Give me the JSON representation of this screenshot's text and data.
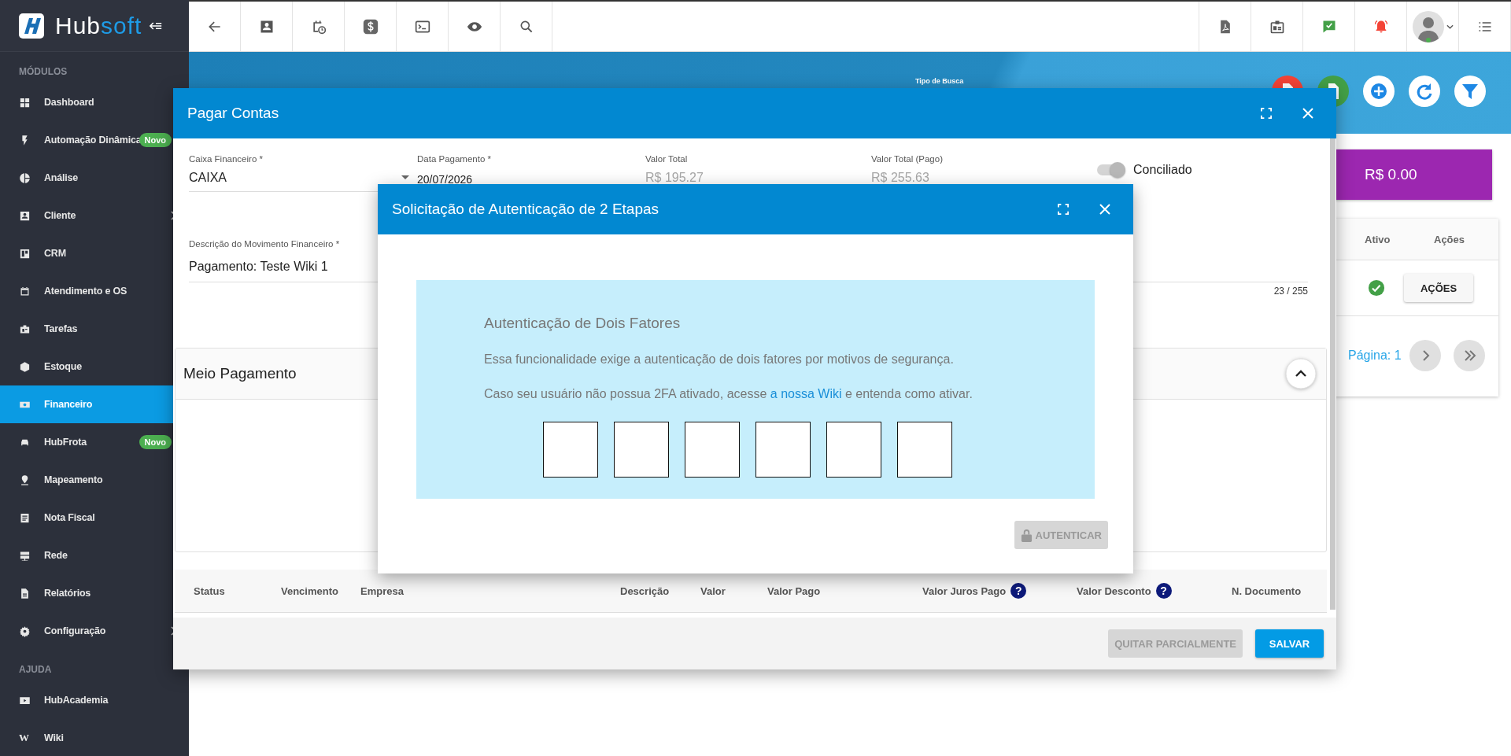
{
  "sidebar": {
    "logo": {
      "primary": "Hub",
      "accent": "soft"
    },
    "sections": [
      {
        "heading": "MÓDULOS",
        "items": [
          {
            "label": "Dashboard",
            "selected": false,
            "expandable": false
          },
          {
            "label": "Automação Dinâmica",
            "selected": false,
            "expandable": false,
            "badge": "Novo"
          },
          {
            "label": "Análise",
            "selected": false,
            "expandable": false
          },
          {
            "label": "Cliente",
            "selected": false,
            "expandable": true
          },
          {
            "label": "CRM",
            "selected": false,
            "expandable": false
          },
          {
            "label": "Atendimento e OS",
            "selected": false,
            "expandable": false
          },
          {
            "label": "Tarefas",
            "selected": false,
            "expandable": false
          },
          {
            "label": "Estoque",
            "selected": false,
            "expandable": false
          },
          {
            "label": "Financeiro",
            "selected": true,
            "expandable": false
          },
          {
            "label": "HubFrota",
            "selected": false,
            "expandable": false,
            "badge": "Novo"
          },
          {
            "label": "Mapeamento",
            "selected": false,
            "expandable": false
          },
          {
            "label": "Nota Fiscal",
            "selected": false,
            "expandable": false
          },
          {
            "label": "Rede",
            "selected": false,
            "expandable": false
          },
          {
            "label": "Relatórios",
            "selected": false,
            "expandable": false
          },
          {
            "label": "Configuração",
            "selected": false,
            "expandable": true
          }
        ]
      },
      {
        "heading": "AJUDA",
        "items": [
          {
            "label": "HubAcademia",
            "selected": false,
            "expandable": false
          },
          {
            "label": "Wiki",
            "selected": false,
            "expandable": false,
            "glyph": "W"
          }
        ]
      }
    ]
  },
  "header": {
    "search_type_label": "Tipo de Busca"
  },
  "summary": {
    "total": "R$ 0.00"
  },
  "list": {
    "columns": [
      "Ativo",
      "Ações"
    ],
    "rows": [
      {
        "active": true,
        "action": "AÇÕES"
      }
    ],
    "pagination": "Página: 1"
  },
  "payment_dialog": {
    "title": "Pagar Contas",
    "fields": [
      {
        "kind": "select",
        "label": "Caixa Financeiro *",
        "value": "CAIXA",
        "disabled": false
      },
      {
        "kind": "date",
        "label": "Data Pagamento *",
        "value": "20/07/2026",
        "disabled": false
      },
      {
        "kind": "readonly",
        "label": "Valor Total",
        "value": "R$ 195.27",
        "disabled": true
      },
      {
        "kind": "readonly",
        "label": "Valor Total (Pago)",
        "value": "R$ 255.63",
        "disabled": true
      }
    ],
    "toggle": {
      "label": "Conciliado",
      "on": true,
      "disabled": true
    },
    "description": {
      "label": "Descrição do Movimento Financeiro *",
      "value": "Pagamento: Teste Wiki 1",
      "counter": "23 / 255"
    },
    "payment_method": {
      "title": "Meio Pagamento",
      "expanded": true
    },
    "table": {
      "columns": [
        {
          "label": "Status"
        },
        {
          "label": "Vencimento"
        },
        {
          "label": "Empresa"
        },
        {
          "label": "Descrição"
        },
        {
          "label": "Valor"
        },
        {
          "label": "Valor Pago"
        },
        {
          "label": "Valor Juros Pago",
          "help": "?"
        },
        {
          "label": "Valor Desconto",
          "help": "?"
        },
        {
          "label": "N. Documento"
        }
      ]
    },
    "buttons": [
      {
        "label": "QUITAR PARCIALMENTE",
        "disabled": true
      },
      {
        "label": "SALVAR",
        "disabled": false
      }
    ]
  },
  "auth_dialog": {
    "title": "Solicitação de Autenticação de 2 Etapas",
    "heading": "Autenticação de Dois Fatores",
    "text": "Essa funcionalidade exige a autenticação de dois fatores por motivos de segurança.",
    "help": {
      "before": "Caso seu usuário não possua 2FA ativado, acesse ",
      "link": "a nossa Wiki",
      "after": " e entenda como ativar."
    },
    "code_fields": [
      {
        "kind": "digit"
      },
      {
        "kind": "digit"
      },
      {
        "kind": "digit"
      },
      {
        "kind": "digit"
      },
      {
        "kind": "digit"
      },
      {
        "kind": "digit"
      }
    ],
    "button": {
      "label": "AUTENTICAR",
      "disabled": true
    }
  }
}
